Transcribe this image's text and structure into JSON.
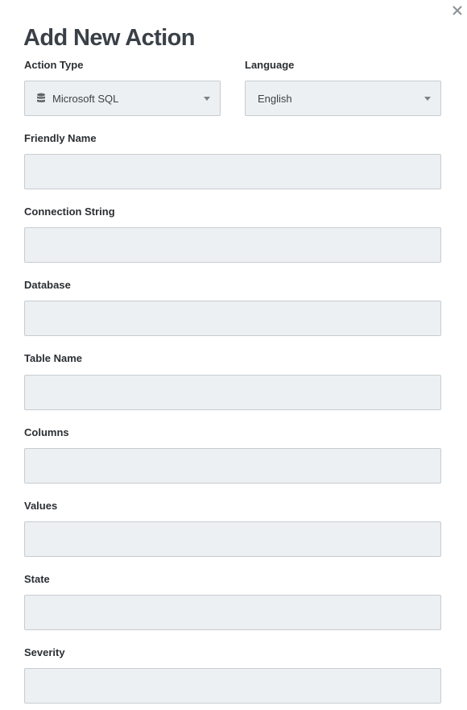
{
  "dialog": {
    "title": "Add New Action",
    "close_symbol": "×"
  },
  "action_type": {
    "label": "Action Type",
    "value": "Microsoft SQL",
    "icon": "database-icon"
  },
  "language": {
    "label": "Language",
    "value": "English"
  },
  "fields": [
    {
      "label": "Friendly Name",
      "value": ""
    },
    {
      "label": "Connection String",
      "value": ""
    },
    {
      "label": "Database",
      "value": ""
    },
    {
      "label": "Table Name",
      "value": ""
    },
    {
      "label": "Columns",
      "value": ""
    },
    {
      "label": "Values",
      "value": ""
    },
    {
      "label": "State",
      "value": ""
    },
    {
      "label": "Severity",
      "value": ""
    }
  ],
  "colors": {
    "field_background": "#edf0f2",
    "field_border": "#c7ccd1",
    "title_text": "#3a4047",
    "icon": "#8b9197"
  }
}
